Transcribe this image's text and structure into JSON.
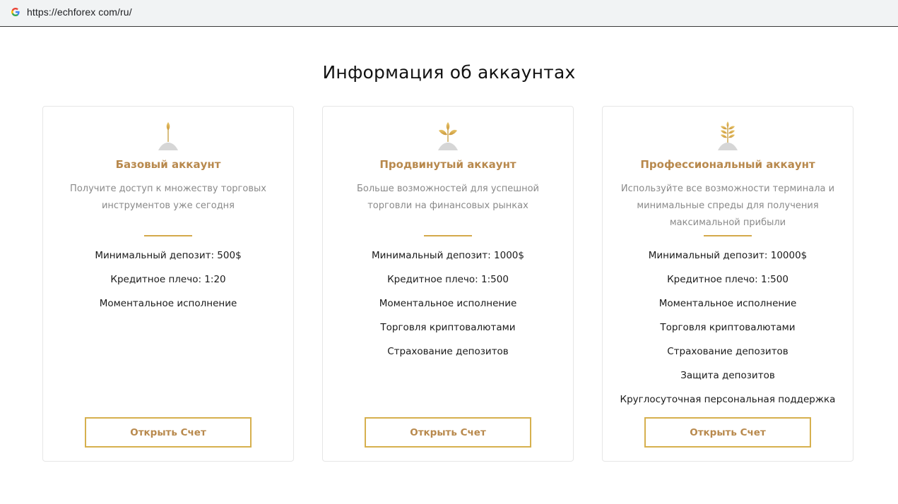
{
  "browser": {
    "url": "https://echforex com/ru/"
  },
  "page": {
    "title": "Информация об аккаунтах"
  },
  "colors": {
    "accent_gold": "#d4a94a",
    "title_brown": "#b8894d",
    "muted_text": "#8a8a8a"
  },
  "cards": [
    {
      "icon": "wheat-sprout-icon",
      "name": "Базовый аккаунт",
      "description": "Получите доступ к множеству торговых инструментов уже сегодня",
      "features": [
        "Минимальный депозит: 500$",
        "Кредитное плечо: 1:20",
        "Моментальное исполнение"
      ],
      "button": "Открыть Счет"
    },
    {
      "icon": "wheat-leaves-icon",
      "name": "Продвинутый аккаунт",
      "description": "Больше возможностей для успешной торговли на финансовых рынках",
      "features": [
        "Минимальный депозит: 1000$",
        "Кредитное плечо: 1:500",
        "Моментальное исполнение",
        "Торговля криптовалютами",
        "Страхование депозитов"
      ],
      "button": "Открыть Счет"
    },
    {
      "icon": "wheat-ear-icon",
      "name": "Профессиональный аккаунт",
      "description": "Используйте все возможности терминала и минимальные спреды для получения максимальной прибыли",
      "features": [
        "Минимальный депозит: 10000$",
        "Кредитное плечо: 1:500",
        "Моментальное исполнение",
        "Торговля криптовалютами",
        "Страхование депозитов",
        "Защита депозитов",
        "Круглосуточная персональная поддержка"
      ],
      "button": "Открыть Счет"
    }
  ]
}
